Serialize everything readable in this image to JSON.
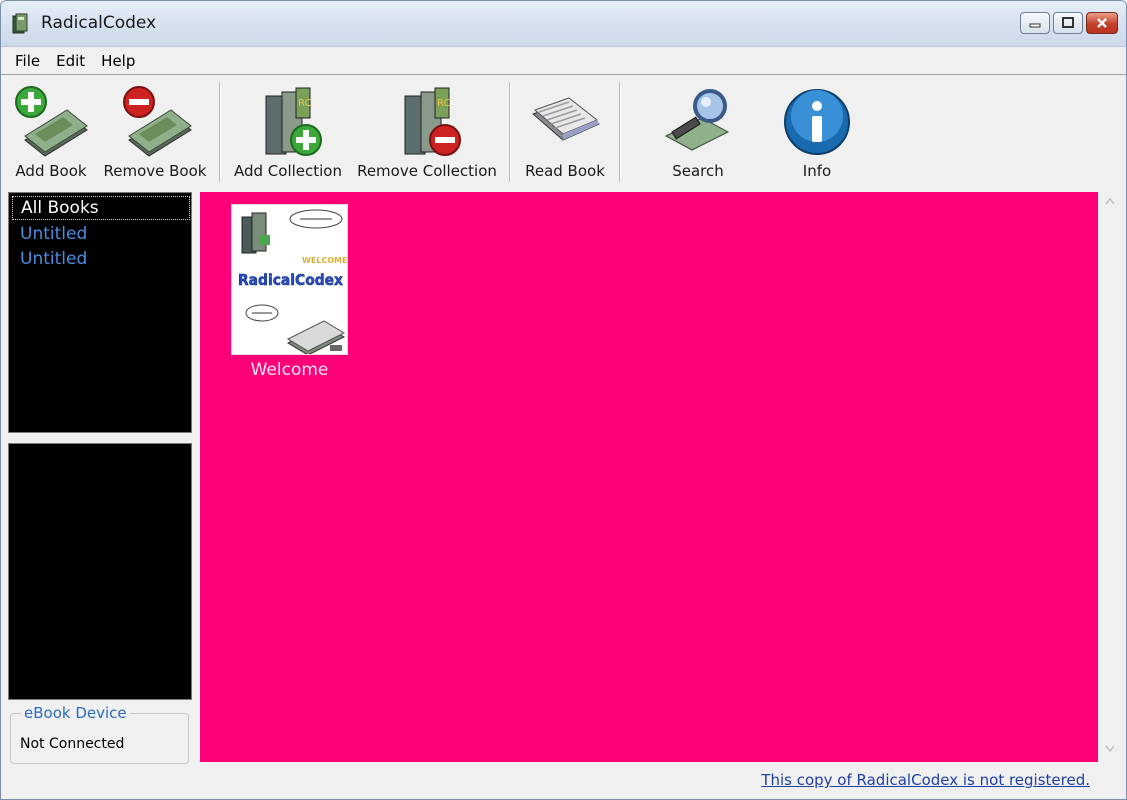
{
  "window": {
    "title": "RadicalCodex"
  },
  "menu": [
    "File",
    "Edit",
    "Help"
  ],
  "toolbar": {
    "add_book": "Add Book",
    "remove_book": "Remove Book",
    "add_collection": "Add Collection",
    "remove_collection": "Remove Collection",
    "read_book": "Read Book",
    "search": "Search",
    "info": "Info"
  },
  "collections": [
    "All Books",
    "Untitled",
    "Untitled"
  ],
  "device": {
    "legend": "eBook Device",
    "status": "Not Connected"
  },
  "books": [
    {
      "title": "Welcome",
      "cover_heading": "WELCOME TO",
      "cover_brand": "RadicalCodex"
    }
  ],
  "status": {
    "registration": "This copy of RadicalCodex is not registered."
  },
  "colors": {
    "content_bg": "#ff0078",
    "panel_bg": "#000000",
    "link": "#1f3fa6"
  }
}
